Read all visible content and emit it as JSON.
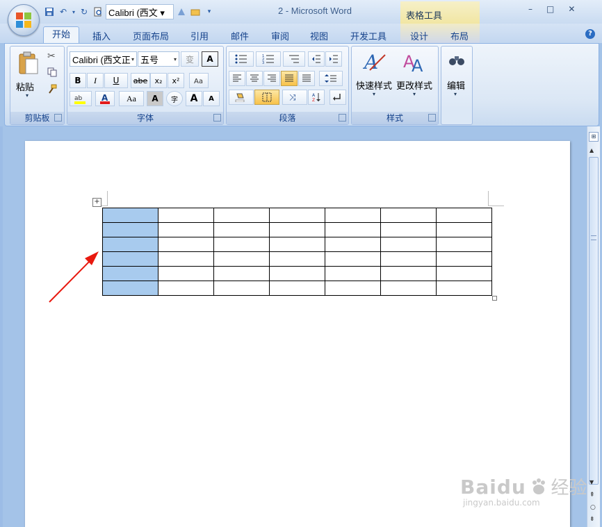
{
  "window": {
    "title": "2 - Microsoft Word",
    "context_tool_title": "表格工具",
    "controls": [
      "–",
      "□",
      "✕"
    ]
  },
  "quick_access": {
    "font_name": "Calibri (西文 ▾"
  },
  "tabs": [
    "开始",
    "插入",
    "页面布局",
    "引用",
    "邮件",
    "审阅",
    "视图",
    "开发工具",
    "设计",
    "布局"
  ],
  "ribbon": {
    "clipboard": {
      "label": "剪贴板",
      "paste": "粘贴"
    },
    "font": {
      "label": "字体",
      "font_name": "Calibri (西文正",
      "font_size": "五号",
      "bold": "B",
      "italic": "I",
      "underline": "U",
      "strike": "abe",
      "subscript": "x₂",
      "superscript": "x²",
      "case": "Aa",
      "grow": "A",
      "shrink": "A",
      "phonetic": "变",
      "charborder": "A",
      "charshade": "A",
      "enclose": "字"
    },
    "paragraph": {
      "label": "段落"
    },
    "styles": {
      "label": "样式",
      "quick_styles": "快速样式",
      "change_styles": "更改样式"
    },
    "editing": {
      "label": "编辑"
    }
  },
  "table": {
    "rows": 6,
    "cols": 7,
    "selected_column": 1
  },
  "watermark": {
    "brand": "Baidu",
    "brand_cn": "经验",
    "url": "jingyan.baidu.com"
  },
  "colors": {
    "accent": "#15428b",
    "selection": "#a8cbee",
    "arrow": "#e8190f"
  }
}
